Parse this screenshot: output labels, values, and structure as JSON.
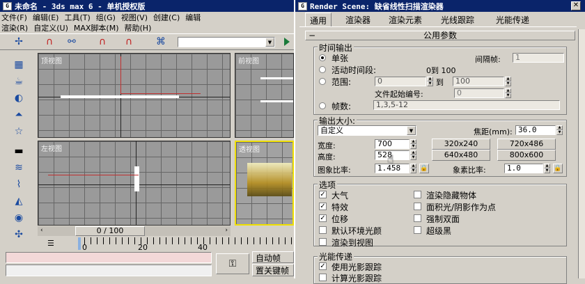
{
  "left_window": {
    "title": "未命名 - 3ds max 6 - 单机授权版",
    "menu_row1": [
      "文件(F)",
      "编辑(E)",
      "工具(T)",
      "组(G)",
      "视图(V)",
      "创建(C)",
      "编辑"
    ],
    "menu_row2": [
      "渲染(R)",
      "自定义(U)",
      "MAXScript 脚本(M)",
      "帮助(H)"
    ],
    "menu_row2_display": [
      "渲染(R)",
      "自定义(U)",
      "MAX脚本(M)",
      "帮助(H)"
    ],
    "viewports": {
      "top": "顶视图",
      "front": "前视图",
      "left": "左视图",
      "perspective": "透视图"
    },
    "time_slider": "0 / 100",
    "track_ticks": [
      "0",
      "20",
      "40"
    ],
    "auto_key": "自动帧",
    "set_key": "置关键帧"
  },
  "render_window": {
    "title": "Render Scene: 缺省线性扫描渲染器",
    "tabs": [
      "通用",
      "渲染器",
      "渲染元素",
      "光线跟踪",
      "光能传递"
    ],
    "rollout": "公用参数",
    "time_output": {
      "group": "时间输出",
      "single": "单张",
      "every_nth_label": "间隔帧:",
      "every_nth_value": "1",
      "active_segment": "活动时间段:",
      "active_range": "0到 100",
      "range": "范围:",
      "range_from": "0",
      "range_to_label": "到",
      "range_to": "100",
      "file_start_label": "文件起始编号:",
      "file_start_value": "0",
      "frames": "帧数:",
      "frames_value": "1,3,5-12"
    },
    "output_size": {
      "group": "输出大小:",
      "preset": "自定义",
      "aperture_label": "焦距(mm):",
      "aperture_value": "36.0",
      "width_label": "宽度:",
      "width_value": "700",
      "height_label": "高度:",
      "height_value": "528",
      "presets": [
        "320x240",
        "720x486",
        "640x480",
        "800x600"
      ],
      "image_aspect_label": "图象比率:",
      "image_aspect_value": "1.458",
      "pixel_aspect_label": "象素比率:",
      "pixel_aspect_value": "1.0"
    },
    "options": {
      "group": "选项",
      "items": [
        {
          "label": "大气",
          "checked": true
        },
        {
          "label": "渲染隐藏物体",
          "checked": false
        },
        {
          "label": "特效",
          "checked": true
        },
        {
          "label": "面积光/阴影作为点",
          "checked": false
        },
        {
          "label": "位移",
          "checked": true
        },
        {
          "label": "强制双面",
          "checked": false
        },
        {
          "label": "默认环境光颜",
          "checked": false
        },
        {
          "label": "超级黑",
          "checked": false
        },
        {
          "label": "渲染到视图",
          "checked": false
        }
      ]
    },
    "radiosity": {
      "group": "光能传递",
      "use": "使用光影跟踪",
      "compute": "计算光影跟踪"
    }
  }
}
